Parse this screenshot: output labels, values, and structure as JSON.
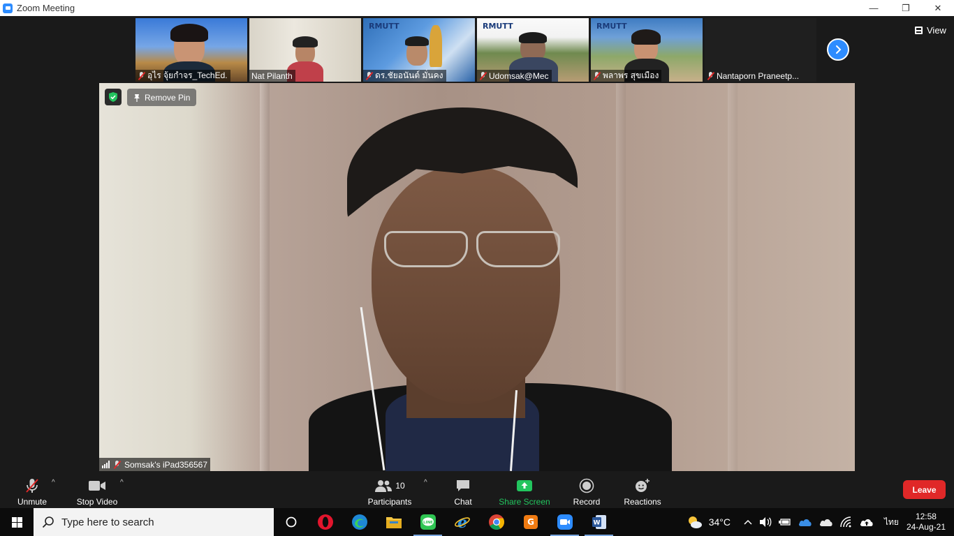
{
  "window": {
    "title": "Zoom Meeting",
    "minimize": "—",
    "restore": "❐",
    "close": "✕"
  },
  "view": {
    "label": "View"
  },
  "thumbnails": [
    {
      "name": "อุไร จุ้ยกำจร_TechEd.",
      "muted": true
    },
    {
      "name": "Nat Pilanth",
      "muted": false
    },
    {
      "name": "ดร.ชัยอนันต์ มั่นคง",
      "muted": true,
      "logo": "RMUTT"
    },
    {
      "name": "Udomsak@Mec",
      "muted": true,
      "logo": "RMUTT"
    },
    {
      "name": "พลาพร สุขเมือง",
      "muted": true,
      "logo": "RMUTT"
    },
    {
      "name": "Nantaporn Praneetp...",
      "muted": true
    }
  ],
  "main": {
    "remove_pin": "Remove Pin",
    "speaker_name": "Somsak's iPad356567"
  },
  "toolbar": {
    "unmute": "Unmute",
    "stop_video": "Stop Video",
    "participants": "Participants",
    "participants_count": "10",
    "chat": "Chat",
    "share_screen": "Share Screen",
    "record": "Record",
    "reactions": "Reactions",
    "leave": "Leave"
  },
  "taskbar": {
    "search_placeholder": "Type here to search",
    "weather_temp": "34°C",
    "language": "ไทย",
    "time": "12:58",
    "date": "24-Aug-21"
  },
  "colors": {
    "accent": "#2d8cff",
    "leave": "#e02828",
    "share": "#22c55e"
  }
}
